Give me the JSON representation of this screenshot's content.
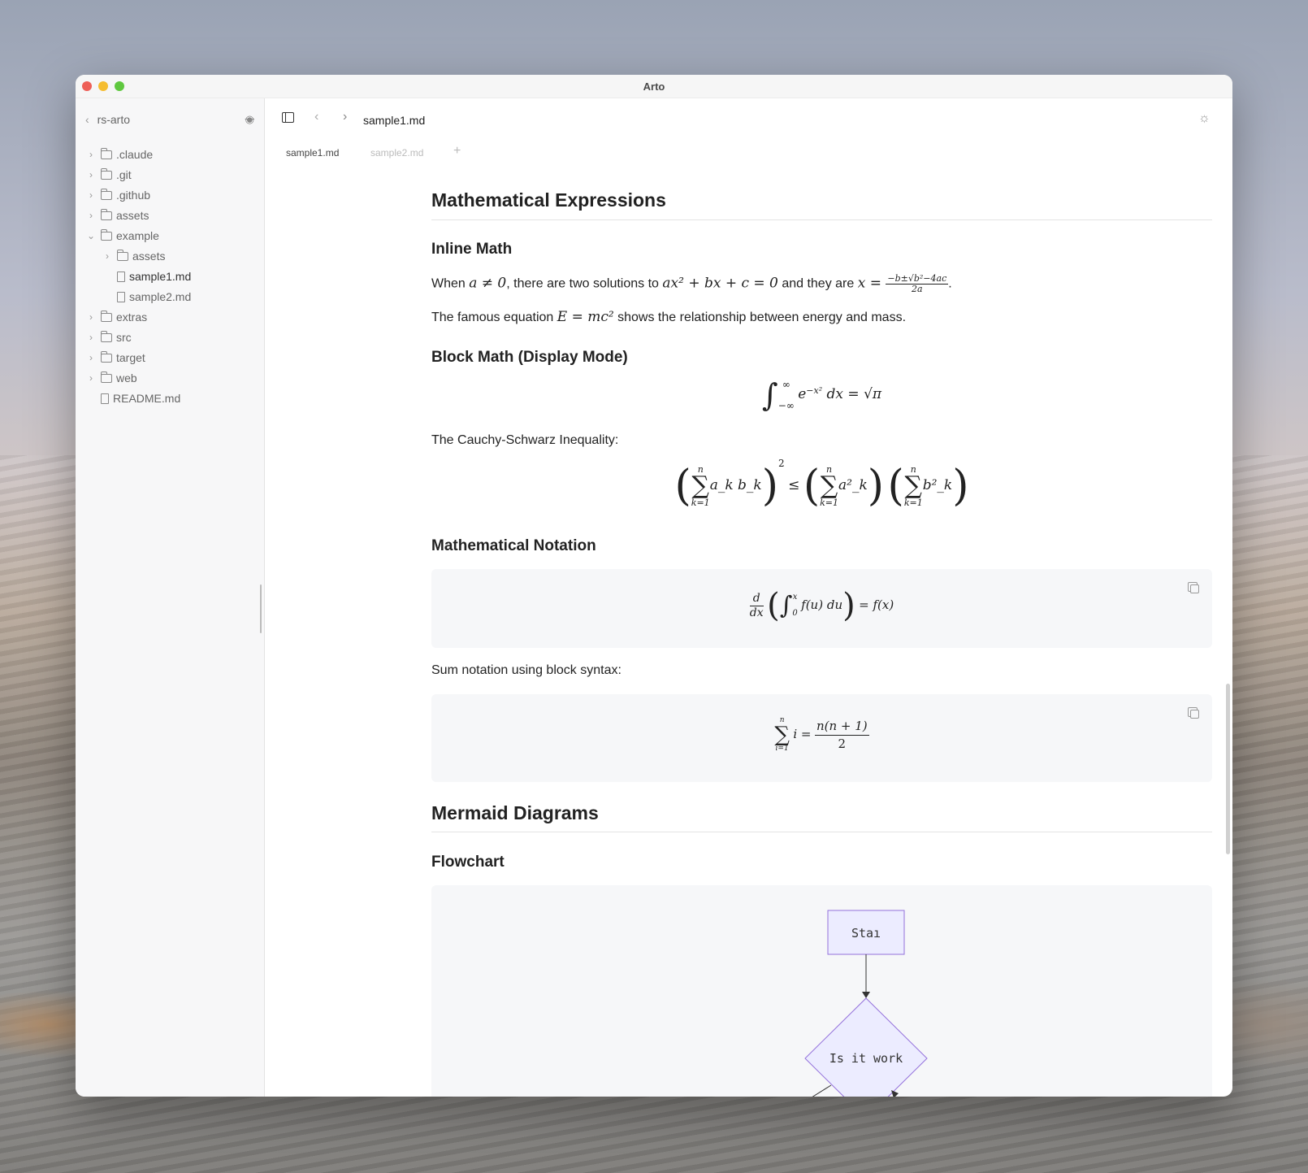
{
  "window": {
    "title": "Arto",
    "traffic_colors": [
      "#ee5f57",
      "#f5bd30",
      "#5fc83f"
    ]
  },
  "sidebar": {
    "root": "rs-arto",
    "items": [
      {
        "label": ".claude",
        "type": "folder",
        "depth": 0,
        "expanded": false
      },
      {
        "label": ".git",
        "type": "folder",
        "depth": 0,
        "expanded": false
      },
      {
        "label": ".github",
        "type": "folder",
        "depth": 0,
        "expanded": false
      },
      {
        "label": "assets",
        "type": "folder",
        "depth": 0,
        "expanded": false
      },
      {
        "label": "example",
        "type": "folder",
        "depth": 0,
        "expanded": true
      },
      {
        "label": "assets",
        "type": "folder",
        "depth": 1,
        "expanded": false
      },
      {
        "label": "sample1.md",
        "type": "file",
        "depth": 1,
        "selected": true
      },
      {
        "label": "sample2.md",
        "type": "file",
        "depth": 1
      },
      {
        "label": "extras",
        "type": "folder",
        "depth": 0,
        "expanded": false
      },
      {
        "label": "src",
        "type": "folder",
        "depth": 0,
        "expanded": false
      },
      {
        "label": "target",
        "type": "folder",
        "depth": 0,
        "expanded": false
      },
      {
        "label": "web",
        "type": "folder",
        "depth": 0,
        "expanded": false
      },
      {
        "label": "README.md",
        "type": "file",
        "depth": 0
      }
    ]
  },
  "toolbar": {
    "filename": "sample1.md"
  },
  "tabs": [
    {
      "label": "sample1.md",
      "active": true
    },
    {
      "label": "sample2.md",
      "active": false
    }
  ],
  "doc": {
    "h_math": "Mathematical Expressions",
    "h_inline": "Inline Math",
    "p1": {
      "t1": "When ",
      "m1": "a ≠ 0",
      "t2": ", there are two solutions to ",
      "m2": "ax² + bx + c = 0",
      "t3": " and they are ",
      "m3": "x = ",
      "num": "−b±√b²−4ac",
      "den": "2a",
      "t4": "."
    },
    "p2": {
      "t1": "The famous equation ",
      "m1": "E = mc²",
      "t2": " shows the relationship between energy and mass."
    },
    "h_block": "Block Math (Display Mode)",
    "integral": {
      "upper": "∞",
      "lower": "−∞",
      "body": "e",
      "exp": "−x²",
      "rest": " dx = √π"
    },
    "cauchy_label": "The Cauchy-Schwarz Inequality:",
    "cauchy": {
      "upper": "n",
      "lower": "k=1",
      "t1": "a_k b_k",
      "sq": "2",
      "leq": "≤",
      "t2": "a²_k",
      "t3": "b²_k"
    },
    "h_notation": "Mathematical Notation",
    "deriv": {
      "num": "d",
      "den": "dx",
      "upper": "x",
      "lower": "0",
      "body": "f(u) du",
      "rhs": "= f(x)"
    },
    "sum_label": "Sum notation using block syntax:",
    "sumeq": {
      "upper": "n",
      "lower": "i=1",
      "body": "i =",
      "num": "n(n + 1)",
      "den": "2"
    },
    "h_mermaid": "Mermaid Diagrams",
    "h_flow": "Flowchart",
    "flow": {
      "start": "Staı",
      "decision": "Is it work"
    }
  }
}
